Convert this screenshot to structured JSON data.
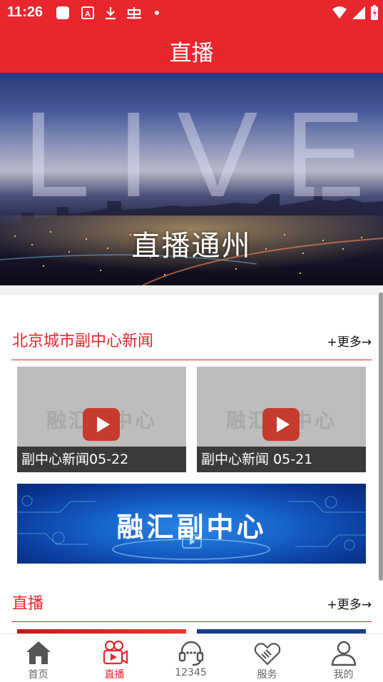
{
  "status_bar": {
    "time": "11:26",
    "icons": [
      "notification-square-icon",
      "text-a-icon",
      "download-icon",
      "bug-icon",
      "dot-icon",
      "wifi-icon",
      "signal-icon",
      "battery-icon"
    ]
  },
  "header": {
    "title": "直播"
  },
  "hero": {
    "bg_text": "LIVE",
    "caption": "直播通州"
  },
  "section_news": {
    "title": "北京城市副中心新闻",
    "more": "+更多→",
    "cards": [
      {
        "watermark": "融汇副中心",
        "caption": "副中心新闻05-22"
      },
      {
        "watermark": "融汇副中心",
        "caption": "副中心新闻 05-21"
      }
    ],
    "banner_text": "融汇副中心"
  },
  "section_live": {
    "title": "直播",
    "more": "+更多→"
  },
  "bottom_nav": {
    "items": [
      {
        "label": "首页",
        "icon": "home-icon"
      },
      {
        "label": "直播",
        "icon": "camera-icon"
      },
      {
        "label": "12345",
        "icon": "headset-icon"
      },
      {
        "label": "服务",
        "icon": "handshake-icon"
      },
      {
        "label": "我的",
        "icon": "profile-icon"
      }
    ],
    "active_index": 1
  },
  "colors": {
    "accent": "#e8262e",
    "inactive": "#666666"
  }
}
